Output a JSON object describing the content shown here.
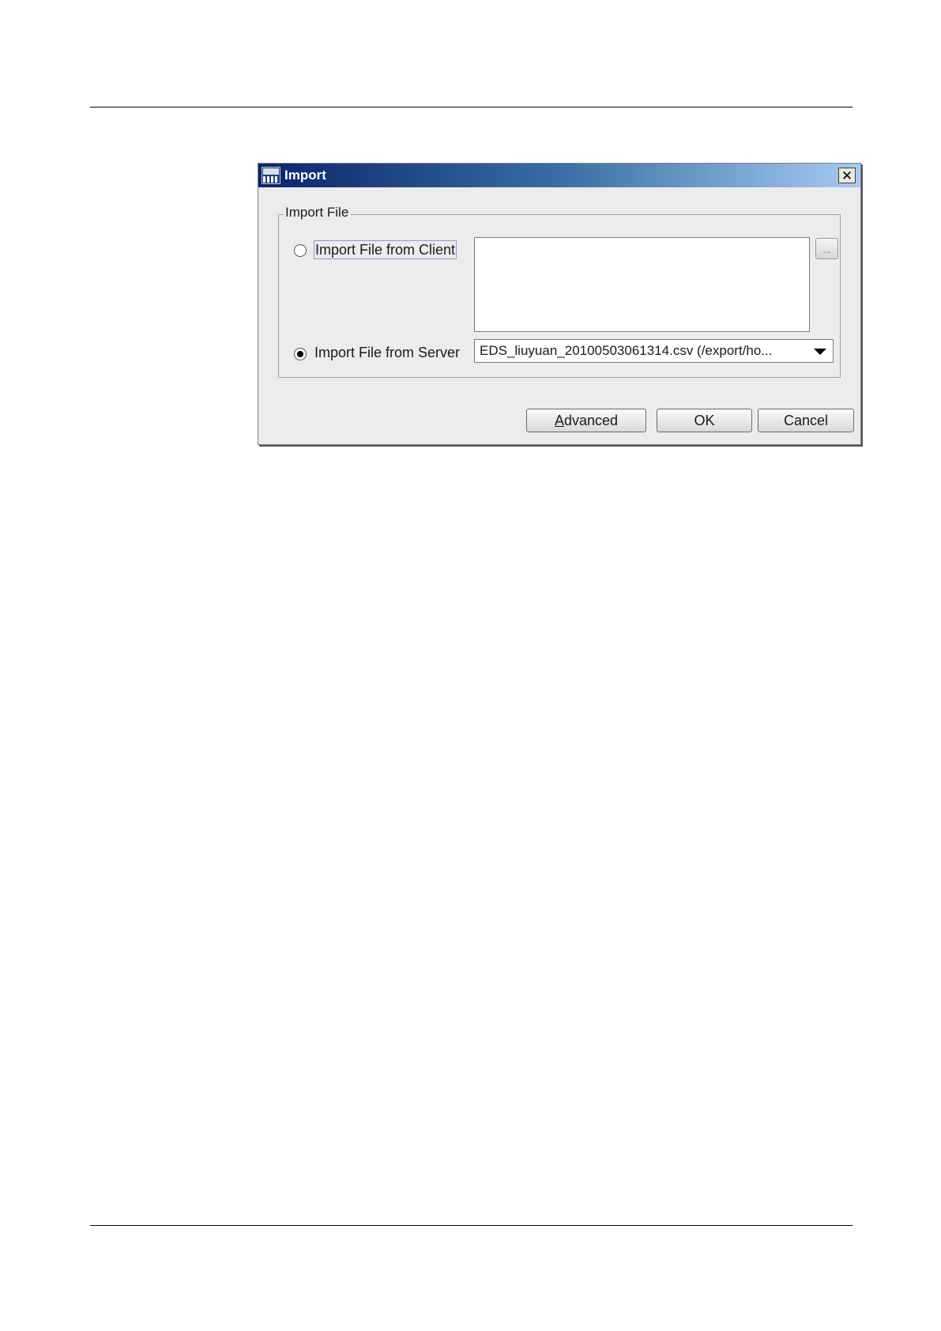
{
  "dialog": {
    "title": "Import",
    "close_label": "✕",
    "group_label": "Import File",
    "client_option": {
      "label": "Import File from Client",
      "selected": false,
      "path_value": "",
      "browse_label": "..."
    },
    "server_option": {
      "label": "Import File from Server",
      "selected": true,
      "selected_file": "EDS_liuyuan_20100503061314.csv (/export/ho..."
    },
    "buttons": {
      "advanced_mnemonic": "A",
      "advanced_rest": "dvanced",
      "ok": "OK",
      "cancel": "Cancel"
    },
    "icons": {
      "app": "app-logo-icon",
      "close": "close-icon",
      "dropdown": "chevron-down-icon"
    }
  }
}
